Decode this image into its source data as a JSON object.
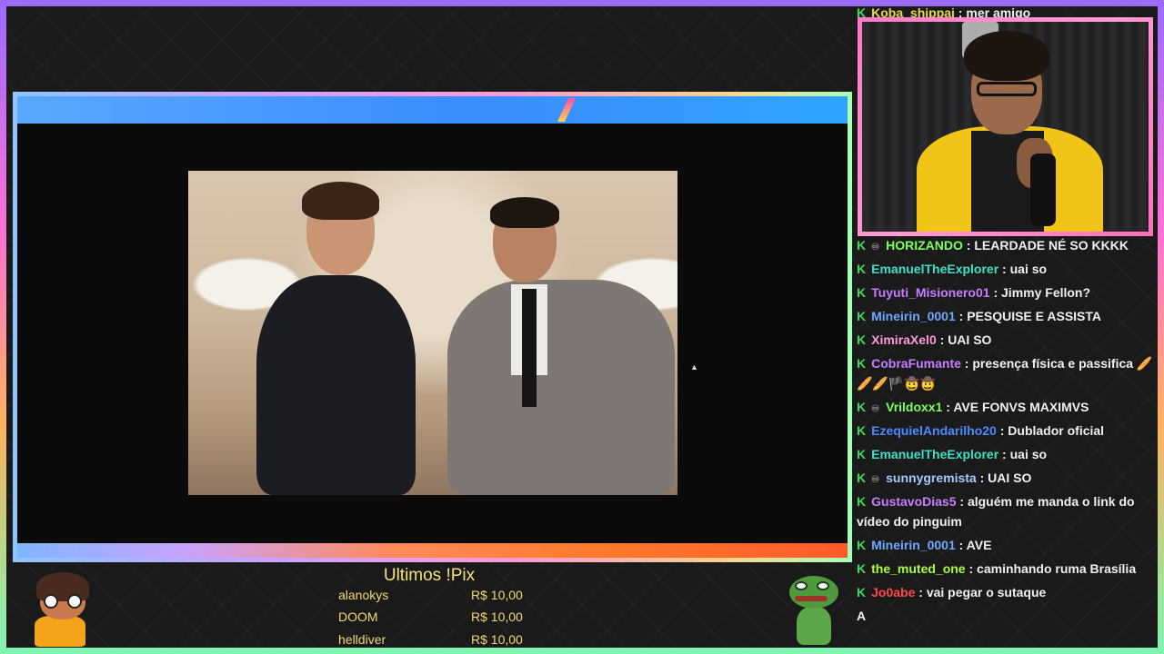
{
  "main_video": {},
  "pix_panel": {
    "title": "Ultimos !Pix",
    "entries": [
      {
        "name": "alanokys",
        "amount": "R$ 10,00"
      },
      {
        "name": "DOOM",
        "amount": "R$ 10,00"
      },
      {
        "name": "helldiver",
        "amount": "R$ 10,00"
      }
    ]
  },
  "chat": {
    "messages": [
      {
        "user": "Koba_shippai",
        "color": "#e8d84a",
        "text": "mer amigo"
      },
      {
        "user": "HORIZANDO",
        "color": "#7dff5c",
        "text": "LEARDADE NÉ SO KKKK",
        "badge": "♾"
      },
      {
        "user": "EmanuelTheExplorer",
        "color": "#3fe0c5",
        "text": "uai so"
      },
      {
        "user": "Tuyuti_Misionero01",
        "color": "#c77dff",
        "text": "Jimmy Fellon?"
      },
      {
        "user": "Mineirin_0001",
        "color": "#6fa8ff",
        "text": "PESQUISE E ASSISTA"
      },
      {
        "user": "XimiraXel0",
        "color": "#ff9bd2",
        "text": "UAI SO"
      },
      {
        "user": "CobraFumante",
        "color": "#c77dff",
        "text": "presença física e passifica 🥖",
        "continuation": "🥖🥖🏴🤠🤠"
      },
      {
        "user": "Vrildoxx1",
        "color": "#7dff5c",
        "text": "AVE FONVS MAXIMVS",
        "badge": "♾"
      },
      {
        "user": "EzequielAndarilho20",
        "color": "#4a8cff",
        "text": "Dublador oficial"
      },
      {
        "user": "EmanuelTheExplorer",
        "color": "#3fe0c5",
        "text": "uai so"
      },
      {
        "user": "sunnygremista",
        "color": "#a8c8ff",
        "text": "UAI SO",
        "badge": "♾"
      },
      {
        "user": "GustavoDias5",
        "color": "#c77dff",
        "text": "alguém me manda o link do",
        "continuation": "vídeo do pinguim"
      },
      {
        "user": "Mineirin_0001",
        "color": "#6fa8ff",
        "text": "AVE"
      },
      {
        "user": "the_muted_one",
        "color": "#a6ff3a",
        "text": "caminhando ruma Brasília"
      },
      {
        "user": "Jo0abe",
        "color": "#ff4a4a",
        "text": "vai pegar o sutaque"
      }
    ],
    "trailing": "A"
  },
  "colors": {
    "k_badge": "#3ddc5c",
    "pix_text": "#f2d878",
    "webcam_border": "#ff7ac7"
  }
}
